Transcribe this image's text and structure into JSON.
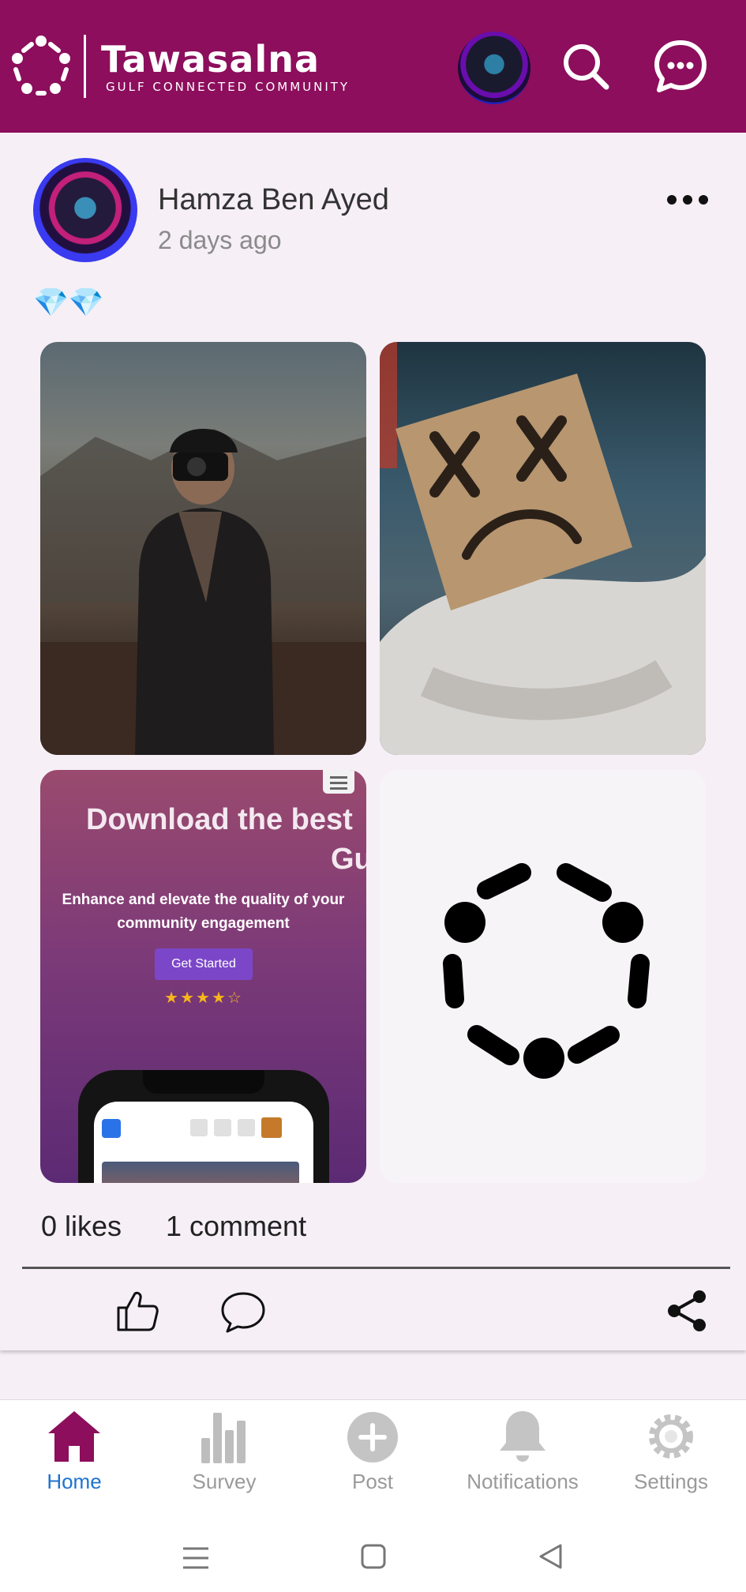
{
  "header": {
    "brand_title": "Tawasalna",
    "brand_subtitle": "Gulf Connected Community",
    "icons": [
      "logo-ring-icon",
      "search-icon",
      "chat-bubble-icon"
    ],
    "color": "#8c0e5c"
  },
  "post": {
    "author": "Hamza Ben Ayed",
    "time": "2 days ago",
    "caption": "💎💎",
    "promo": {
      "headline_line1": "Download the best",
      "headline_line2": "Gu",
      "subtitle": "Enhance and elevate the quality of your community engagement",
      "button": "Get Started",
      "stars": "★★★★☆"
    },
    "likes": "0 likes",
    "comments": "1 comment",
    "actions": [
      "like-icon",
      "comment-icon",
      "share-icon"
    ]
  },
  "bottom_nav": {
    "items": [
      {
        "label": "Home",
        "icon": "home-icon",
        "active": true
      },
      {
        "label": "Survey",
        "icon": "bar-chart-icon"
      },
      {
        "label": "Post",
        "icon": "plus-circle-icon"
      },
      {
        "label": "Notifications",
        "icon": "bell-icon"
      },
      {
        "label": "Settings",
        "icon": "gear-icon"
      }
    ],
    "active_color": "#1e73d0",
    "home_icon_color": "#8c0e5c"
  },
  "system_nav": [
    "menu-icon",
    "square-icon",
    "back-triangle-icon"
  ]
}
